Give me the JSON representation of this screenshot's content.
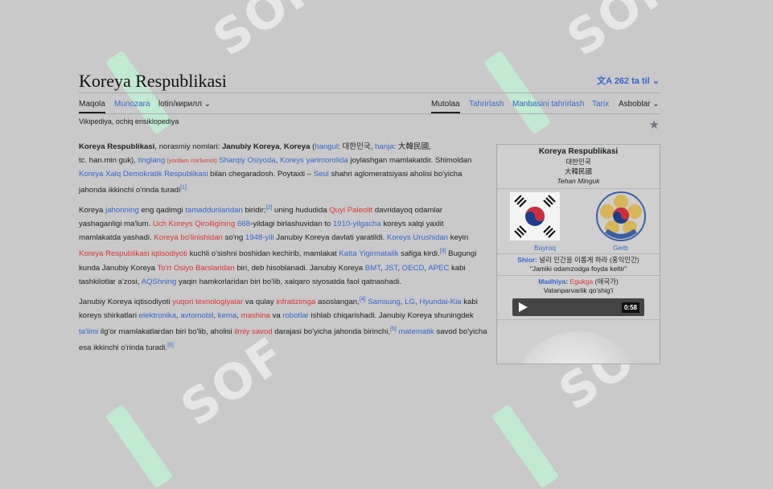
{
  "header": {
    "title": "Koreya Respublikasi",
    "languages": "262 ta til",
    "tagline": "Vikipediya, ochiq ensiklopediya"
  },
  "tabs_left": [
    "Maqola",
    "Munozara",
    "lotin/кирилл"
  ],
  "tabs_right": [
    "Mutolaa",
    "Tahrirlash",
    "Manbasini tahrirlash",
    "Tarix",
    "Asboblar"
  ],
  "infobox": {
    "title": "Koreya Respublikasi",
    "native1": "대한민국",
    "native2": "大韓民國",
    "romanized": "Tehan Minguk",
    "flag_caption": "Bayroq",
    "emblem_caption": "Gerb",
    "motto_label": "Shior:",
    "motto_native": "널리 인간을 이롭게 하라 (홍익인간)",
    "motto_translation": "\"Jamiki odamzodga foyda keltir\"",
    "anthem_label": "Madhiya:",
    "anthem_name": "Egukga",
    "anthem_native": "(애국가)",
    "anthem_translation": "Vatanparvarlik qo'shig'i",
    "audio_duration": "0:58"
  },
  "article": {
    "p1": {
      "a": "Koreya Respublikasi",
      "b": ", norasmiy nomlari: ",
      "c": "Janubiy Koreya",
      "d": ", ",
      "e": "Koreya",
      "f": " (",
      "g": "hangul",
      "h": ": 대한민국, ",
      "i": "hanja",
      "j": ": 大韓民國,",
      "k": "tc. han.min guk), ",
      "l": "tinglang",
      "m": " (yordam ma'lumot)",
      "n": " Sharqiy Osiyoda",
      "o": ", ",
      "pp": "Koreys yarimorolida",
      "q": " joylashgan mamlakatdir. Shimoldan ",
      "r": "Koreya Xalq Demokratik Respublikasi",
      "s": " bilan chegaradosh. Poytaxti – ",
      "t": "Seul",
      "u": " shahri aglomeratsiyasi aholisi bo'yicha jahonda ikkinchi o'rinda turadi",
      "ref": "[1]"
    },
    "p2": {
      "a": "Koreya ",
      "b": "jahonning",
      "c": " eng qadimgi ",
      "d": "tamaddunlaridan",
      "e": " biridir;",
      "ref2": "[2]",
      "f": " uning hududida ",
      "g": "Quyi Paleolit",
      "h": " davridayoq odamlar yashaganligi ma'lum. ",
      "i": "Uch Koreys Qirolligining",
      "j": " ",
      "k": "668",
      "l": "-yildagi birlashuvidan to ",
      "m": "1910-yilgacha",
      "n": " koreys xalqi yaxlit mamlakatda yashadi. ",
      "o": "Koreya bo'linishidan",
      "pp": " so'ng ",
      "q": "1948-yili",
      "r": " Janubiy Koreya davlati yaratildi. ",
      "s": "Koreys Urushidan",
      "t": " keyin ",
      "u": "Koreya Respublikasi iqtisodiyoti",
      "v": " kuchli o'sishni boshidan kechirib, mamlakat ",
      "w": "Katta Yigirmatalik",
      "x": " safiga kirdi.",
      "ref3": "[3]",
      "y": " Bugungi kunda Janubiy Koreya ",
      "z": "To'rt Osiyo Barslaridan",
      "aa": " biri, deb hisoblanadi. Janubiy Koreya ",
      "ab": "BMT",
      "ac": ", ",
      "ad": "JST",
      "ae": ", ",
      "af": "OECD",
      "ag": ", ",
      "ah": "APEC",
      "ai": " kabi tashkilotlar a'zosi, ",
      "aj": "AQShning",
      "ak": " yaqin hamkorlaridan biri bo'lib, xalqaro siyosatda faol qatnashadi."
    },
    "p3": {
      "a": "Janubiy Koreya iqtisodiyoti ",
      "b": "yuqori texnologiyalar",
      "c": " va qulay ",
      "d": "infratizimga",
      "e": " asoslangan,",
      "ref4": "[4]",
      "f": " ",
      "g": "Samsung",
      "h": ", ",
      "i": "LG",
      "j": ", ",
      "k": "Hyundai-Kia",
      "l": " kabi koreys shirkatlari ",
      "m": "elektronika",
      "n": ", ",
      "o": "avtomobil",
      "pp": ", ",
      "q": "kema",
      "r": ", ",
      "s": "mashina",
      "t": " va ",
      "u": "robotlar",
      "v": " ishlab chiqarishadi. Janubiy Koreya shuningdek ",
      "w": "ta'limi",
      "x": " ilg'or mamlakatlardan biri bo'lib, aholisi ",
      "y": "ilmiy savod",
      "z": " darajasi bo'yicha jahonda birinchi,",
      "ref5": "[5]",
      "aa": " ",
      "ab": "matematik",
      "ac": " savod bo'yicha esa ikkinchi o'rinda turadi.",
      "ref6": "[6]"
    }
  },
  "watermark": "SOF"
}
